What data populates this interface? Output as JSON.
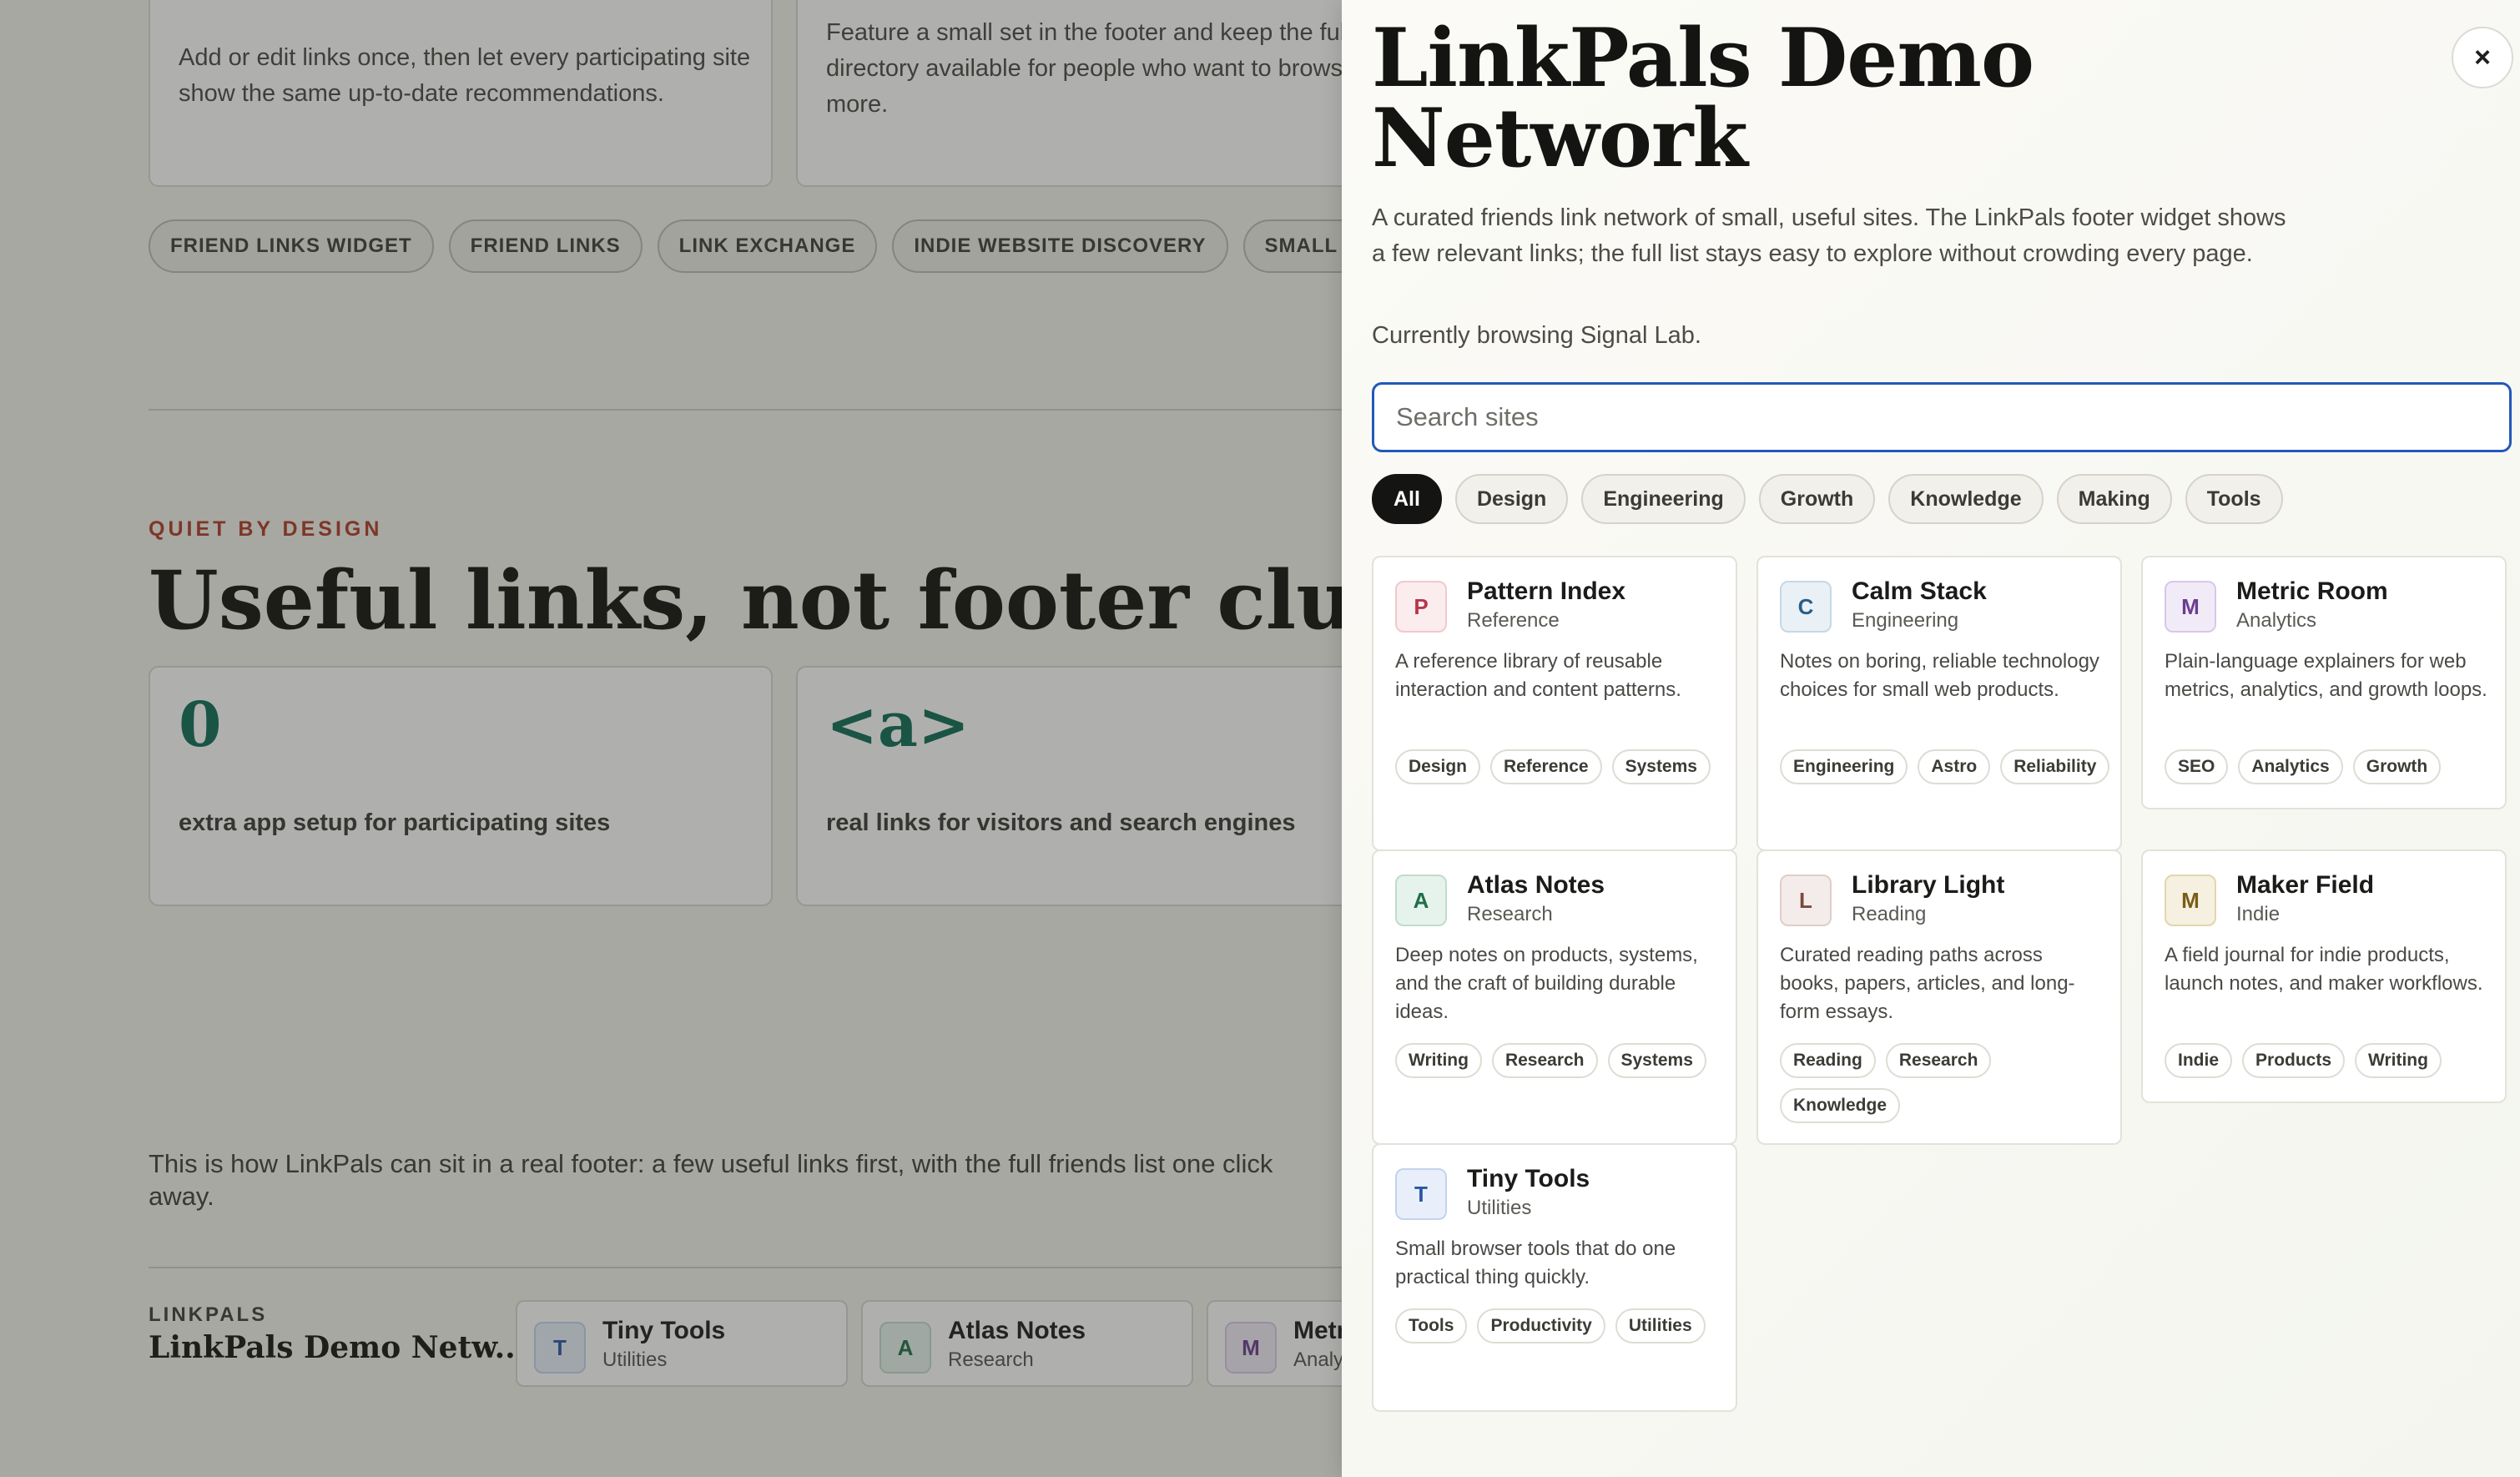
{
  "background": {
    "top_cards": [
      {
        "text": "Add or edit links once, then let every participating site show the same up-to-date recommendations."
      },
      {
        "text": "Feature a small set in the footer and keep the full directory available for people who want to browse more."
      }
    ],
    "chips": [
      "FRIEND LINKS WIDGET",
      "FRIEND LINKS",
      "LINK EXCHANGE",
      "INDIE WEBSITE DISCOVERY",
      "SMALL WEB"
    ],
    "kicker": "QUIET BY DESIGN",
    "headline": "Useful links, not footer clutter.",
    "stats": [
      {
        "value": "0",
        "label": "extra app setup for participating sites"
      },
      {
        "value": "<a>",
        "label": "real links for visitors and search engines"
      }
    ],
    "footer_note": "This is how LinkPals can sit in a real footer: a few useful links first, with the full friends list one click away.",
    "footer_brand_kicker": "LINKPALS",
    "footer_brand_name": "LinkPals Demo Netw...",
    "footer_links": [
      {
        "initial": "T",
        "name": "Tiny Tools",
        "category": "Utilities"
      },
      {
        "initial": "A",
        "name": "Atlas Notes",
        "category": "Research"
      },
      {
        "initial": "M",
        "name": "Metric Room",
        "category": "Analytics"
      }
    ]
  },
  "drawer": {
    "title": "LinkPals Demo Network",
    "close_icon": "×",
    "description": "A curated friends link network of small, useful sites. The LinkPals footer widget shows a few relevant links; the full list stays easy to explore without crowding every page.",
    "current": "Currently browsing Signal Lab.",
    "search": {
      "placeholder": "Search sites",
      "value": ""
    },
    "filters": [
      {
        "label": "All",
        "active": true
      },
      {
        "label": "Design"
      },
      {
        "label": "Engineering"
      },
      {
        "label": "Growth"
      },
      {
        "label": "Knowledge"
      },
      {
        "label": "Making"
      },
      {
        "label": "Tools"
      }
    ],
    "sites": [
      {
        "initial": "P",
        "name": "Pattern Index",
        "category": "Reference",
        "description": "A reference library of reusable interaction and content patterns.",
        "tags": [
          "Design",
          "Reference",
          "Systems"
        ],
        "color": "red"
      },
      {
        "initial": "C",
        "name": "Calm Stack",
        "category": "Engineering",
        "description": "Notes on boring, reliable technology choices for small web products.",
        "tags": [
          "Engineering",
          "Astro",
          "Reliability"
        ],
        "color": "blue"
      },
      {
        "initial": "M",
        "name": "Metric Room",
        "category": "Analytics",
        "description": "Plain-language explainers for web metrics, analytics, and growth loops.",
        "tags": [
          "SEO",
          "Analytics",
          "Growth"
        ],
        "color": "purple"
      },
      {
        "initial": "A",
        "name": "Atlas Notes",
        "category": "Research",
        "description": "Deep notes on products, systems, and the craft of building durable ideas.",
        "tags": [
          "Writing",
          "Research",
          "Systems"
        ],
        "color": "green"
      },
      {
        "initial": "L",
        "name": "Library Light",
        "category": "Reading",
        "description": "Curated reading paths across books, papers, articles, and long-form essays.",
        "tags": [
          "Reading",
          "Research",
          "Knowledge"
        ],
        "color": "brown"
      },
      {
        "initial": "M",
        "name": "Maker Field",
        "category": "Indie",
        "description": "A field journal for indie products, launch notes, and maker workflows.",
        "tags": [
          "Indie",
          "Products",
          "Writing"
        ],
        "color": "gold"
      },
      {
        "initial": "T",
        "name": "Tiny Tools",
        "category": "Utilities",
        "description": "Small browser tools that do one practical thing quickly.",
        "tags": [
          "Tools",
          "Productivity",
          "Utilities"
        ],
        "color": "tblue"
      }
    ]
  }
}
